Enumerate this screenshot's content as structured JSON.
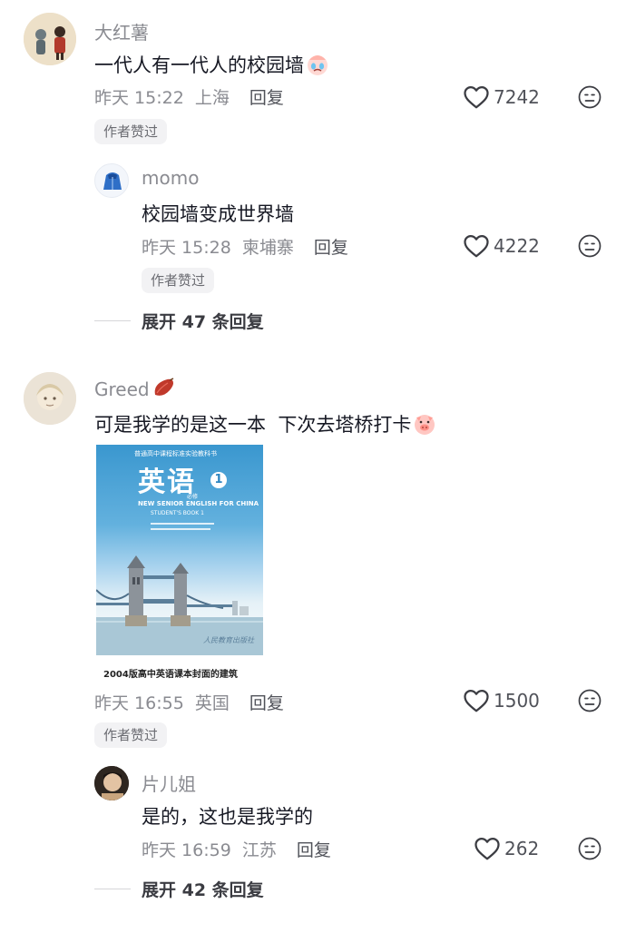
{
  "comments": [
    {
      "username": "大红薯",
      "text": "一代人有一代人的校园墙",
      "emoji": "crying-face",
      "time": "昨天 15:22",
      "location": "上海",
      "reply": "回复",
      "likes": "7242",
      "badge": "作者赞过",
      "replies": [
        {
          "username": "momo",
          "text": "校园墙变成世界墙",
          "time": "昨天 15:28",
          "location": "柬埔寨",
          "reply": "回复",
          "likes": "4222",
          "badge": "作者赞过"
        }
      ],
      "expand": "展开 47 条回复"
    },
    {
      "username": "Greed",
      "username_emoji": "sweet-potato",
      "text": "可是我学的是这一本  下次去塔桥打卡",
      "emoji": "pig-face",
      "image": {
        "series": "普通高中课程标准实验教科书",
        "title": "英语",
        "volume": "1",
        "required": "必修",
        "subtitle_en": "NEW SENIOR ENGLISH FOR CHINA",
        "book_no": "STUDENT'S BOOK 1",
        "publisher": "人民教育出版社",
        "caption": "2004版高中英语课本封面的建筑"
      },
      "time": "昨天 16:55",
      "location": "英国",
      "reply": "回复",
      "likes": "1500",
      "badge": "作者赞过",
      "replies": [
        {
          "username": "片儿姐",
          "text": "是的，这也是我学的",
          "time": "昨天 16:59",
          "location": "江苏",
          "reply": "回复",
          "likes": "262"
        }
      ],
      "expand": "展开 42 条回复"
    }
  ],
  "colors": {
    "meta": "#8a8b91",
    "text": "#161823",
    "badge_bg": "#f2f2f4"
  }
}
